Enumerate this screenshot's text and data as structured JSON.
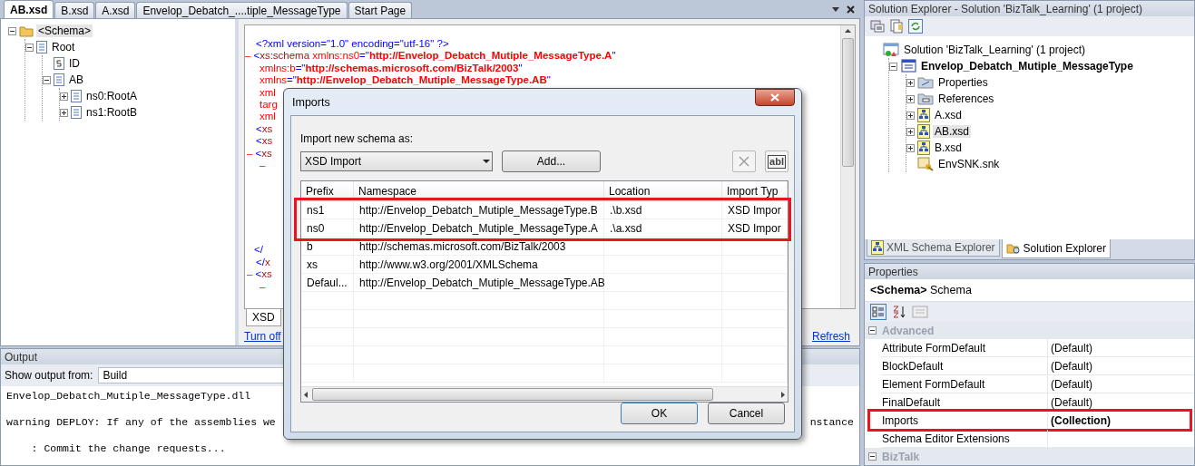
{
  "document_tabs": [
    {
      "label": "AB.xsd",
      "selected": true
    },
    {
      "label": "B.xsd",
      "selected": false
    },
    {
      "label": "A.xsd",
      "selected": false
    },
    {
      "label": "Envelop_Debatch_....tiple_MessageType",
      "selected": false
    },
    {
      "label": "Start Page",
      "selected": false
    }
  ],
  "schema_tree": [
    {
      "label": "<Schema>",
      "kind": "schema",
      "selected": true,
      "expanded": true,
      "children": [
        {
          "label": "Root",
          "kind": "record",
          "selected": false,
          "expanded": true,
          "children": [
            {
              "label": "ID",
              "kind": "field",
              "selected": false
            },
            {
              "label": "AB",
              "kind": "record",
              "selected": false,
              "expanded": true,
              "children": [
                {
                  "label": "ns0:RootA",
                  "kind": "record",
                  "selected": false,
                  "expanded": false
                },
                {
                  "label": "ns1:RootB",
                  "kind": "record",
                  "selected": false,
                  "expanded": false
                }
              ]
            }
          ]
        }
      ]
    }
  ],
  "xml_lines": [
    {
      "kind": "decl",
      "parts": [
        {
          "kind": "pi",
          "text": "<?xml version=\"1.0\" encoding=\"utf-16\" ?>"
        }
      ]
    },
    {
      "kind": "open",
      "toggle": "–",
      "parts": [
        {
          "kind": "punct",
          "text": "<"
        },
        {
          "kind": "tag",
          "text": "xs:schema "
        },
        {
          "kind": "attr",
          "text": "xmlns:ns0"
        },
        {
          "kind": "punct",
          "text": "=\""
        },
        {
          "kind": "value",
          "text": "http://Envelop_Debatch_Mutiple_MessageType.A"
        },
        {
          "kind": "punct",
          "text": "\""
        }
      ]
    },
    {
      "kind": "cont",
      "parts": [
        {
          "kind": "attr",
          "text": "xmlns:b"
        },
        {
          "kind": "punct",
          "text": "=\""
        },
        {
          "kind": "value",
          "text": "http://schemas.microsoft.com/BizTalk/2003"
        },
        {
          "kind": "punct",
          "text": "\""
        }
      ]
    },
    {
      "kind": "cont",
      "parts": [
        {
          "kind": "attr",
          "text": "xmlns"
        },
        {
          "kind": "punct",
          "text": "=\""
        },
        {
          "kind": "value",
          "text": "http://Envelop_Debatch_Mutiple_MessageType.AB"
        },
        {
          "kind": "punct",
          "text": "\""
        }
      ]
    },
    {
      "kind": "cont",
      "parts": [
        {
          "kind": "attr",
          "text": "xml"
        }
      ]
    },
    {
      "kind": "cont",
      "parts": [
        {
          "kind": "attr",
          "text": "targ"
        }
      ]
    },
    {
      "kind": "cont",
      "parts": [
        {
          "kind": "attr",
          "text": "xml"
        }
      ]
    },
    {
      "kind": "child",
      "parts": [
        {
          "kind": "punct",
          "text": "<"
        },
        {
          "kind": "tag",
          "text": "xs"
        }
      ]
    },
    {
      "kind": "child",
      "parts": [
        {
          "kind": "punct",
          "text": "<"
        },
        {
          "kind": "tag",
          "text": "xs"
        }
      ]
    },
    {
      "kind": "child-open",
      "toggle": "–",
      "parts": [
        {
          "kind": "punct",
          "text": "<"
        },
        {
          "kind": "tag",
          "text": "xs"
        }
      ]
    },
    {
      "kind": "nested",
      "toggle": "–"
    },
    {
      "kind": "child-after-gap",
      "parts": [
        {
          "kind": "punct",
          "text": "</"
        }
      ]
    },
    {
      "kind": "child",
      "parts": [
        {
          "kind": "punct",
          "text": "</"
        },
        {
          "kind": "tag",
          "text": "x"
        }
      ]
    },
    {
      "kind": "child-open",
      "toggle": "–",
      "parts": [
        {
          "kind": "punct",
          "text": "<"
        },
        {
          "kind": "tag",
          "text": "xs"
        }
      ]
    },
    {
      "kind": "nested",
      "toggle": "–"
    }
  ],
  "editor_tab": {
    "label": "XSD",
    "selected": true
  },
  "editor_links": {
    "left": "Turn off",
    "right": "Refresh"
  },
  "output": {
    "title": "Output",
    "source_label": "Show output from:",
    "source": "Build",
    "lines": [
      {
        "text": "Envelop_Debatch_Mutiple_MessageType.dll"
      },
      {
        "text": "warning DEPLOY: If any of the assemblies we",
        "tail": "nstance"
      },
      {
        "text": "    : Commit the change requests..."
      }
    ]
  },
  "solution_explorer": {
    "title": "Solution Explorer - Solution 'BizTalk_Learning' (1 project)",
    "tree": [
      {
        "label": "Solution 'BizTalk_Learning' (1 project)",
        "kind": "solution",
        "selected": false,
        "children": [
          {
            "label": "Envelop_Debatch_Mutiple_MessageType",
            "kind": "project",
            "selected": false,
            "expanded": true,
            "children": [
              {
                "label": "Properties",
                "kind": "properties",
                "selected": false,
                "expanded": false
              },
              {
                "label": "References",
                "kind": "references",
                "selected": false,
                "expanded": false
              },
              {
                "label": "A.xsd",
                "kind": "schema",
                "selected": false,
                "expanded": false
              },
              {
                "label": "AB.xsd",
                "kind": "schema",
                "selected": true,
                "expanded": false
              },
              {
                "label": "B.xsd",
                "kind": "schema",
                "selected": false,
                "expanded": false
              },
              {
                "label": "EnvSNK.snk",
                "kind": "key",
                "selected": false
              }
            ]
          }
        ]
      }
    ],
    "tabs": [
      {
        "label": "XML Schema Explorer",
        "kind": "schema",
        "selected": false
      },
      {
        "label": "Solution Explorer",
        "kind": "solution",
        "selected": true
      }
    ]
  },
  "properties": {
    "title": "Properties",
    "object": "**<Schema>** Schema",
    "categories": [
      {
        "name": "Advanced",
        "expanded": true,
        "rows": [
          {
            "name": "Attribute FormDefault",
            "value": "(Default)",
            "modified": false,
            "highlighted": false
          },
          {
            "name": "BlockDefault",
            "value": "(Default)",
            "modified": false,
            "highlighted": false
          },
          {
            "name": "Element FormDefault",
            "value": "(Default)",
            "modified": false,
            "highlighted": false
          },
          {
            "name": "FinalDefault",
            "value": "(Default)",
            "modified": false,
            "highlighted": false
          },
          {
            "name": "Imports",
            "value": "(Collection)",
            "modified": true,
            "highlighted": true
          },
          {
            "name": "Schema Editor Extensions",
            "highlighted": false
          }
        ]
      },
      {
        "name": "BizTalk",
        "expanded": true
      }
    ]
  },
  "dialog": {
    "title": "Imports",
    "import_label": "Import new schema as:",
    "import_type": "XSD Import",
    "add_button": "Add...",
    "rename_button": "abl",
    "columns": [
      "Prefix",
      "Namespace",
      "Location",
      "Import Typ"
    ],
    "rows": [
      {
        "cells": [
          "ns1",
          "http://Envelop_Debatch_Mutiple_MessageType.B",
          ".\\b.xsd",
          "XSD Impor"
        ],
        "highlighted": true
      },
      {
        "cells": [
          "ns0",
          "http://Envelop_Debatch_Mutiple_MessageType.A",
          ".\\a.xsd",
          "XSD Impor"
        ],
        "highlighted": true
      },
      {
        "cells": [
          "b",
          "http://schemas.microsoft.com/BizTalk/2003"
        ],
        "highlighted": false
      },
      {
        "cells": [
          "xs",
          "http://www.w3.org/2001/XMLSchema"
        ],
        "highlighted": false
      },
      {
        "cells": [
          "Defaul...",
          "http://Envelop_Debatch_Mutiple_MessageType.AB"
        ],
        "highlighted": false
      }
    ],
    "ok": "OK",
    "cancel": "Cancel"
  }
}
